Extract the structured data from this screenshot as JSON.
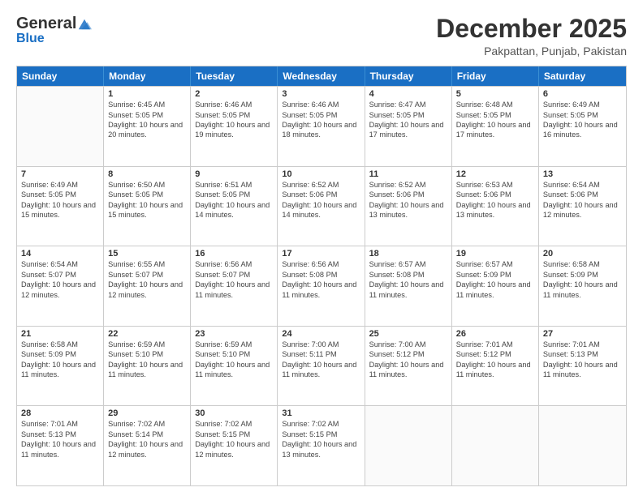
{
  "logo": {
    "general": "General",
    "blue": "Blue"
  },
  "header": {
    "month_year": "December 2025",
    "location": "Pakpattan, Punjab, Pakistan"
  },
  "days_of_week": [
    "Sunday",
    "Monday",
    "Tuesday",
    "Wednesday",
    "Thursday",
    "Friday",
    "Saturday"
  ],
  "weeks": [
    [
      {
        "day": "",
        "sunrise": "",
        "sunset": "",
        "daylight": ""
      },
      {
        "day": "1",
        "sunrise": "Sunrise: 6:45 AM",
        "sunset": "Sunset: 5:05 PM",
        "daylight": "Daylight: 10 hours and 20 minutes."
      },
      {
        "day": "2",
        "sunrise": "Sunrise: 6:46 AM",
        "sunset": "Sunset: 5:05 PM",
        "daylight": "Daylight: 10 hours and 19 minutes."
      },
      {
        "day": "3",
        "sunrise": "Sunrise: 6:46 AM",
        "sunset": "Sunset: 5:05 PM",
        "daylight": "Daylight: 10 hours and 18 minutes."
      },
      {
        "day": "4",
        "sunrise": "Sunrise: 6:47 AM",
        "sunset": "Sunset: 5:05 PM",
        "daylight": "Daylight: 10 hours and 17 minutes."
      },
      {
        "day": "5",
        "sunrise": "Sunrise: 6:48 AM",
        "sunset": "Sunset: 5:05 PM",
        "daylight": "Daylight: 10 hours and 17 minutes."
      },
      {
        "day": "6",
        "sunrise": "Sunrise: 6:49 AM",
        "sunset": "Sunset: 5:05 PM",
        "daylight": "Daylight: 10 hours and 16 minutes."
      }
    ],
    [
      {
        "day": "7",
        "sunrise": "Sunrise: 6:49 AM",
        "sunset": "Sunset: 5:05 PM",
        "daylight": "Daylight: 10 hours and 15 minutes."
      },
      {
        "day": "8",
        "sunrise": "Sunrise: 6:50 AM",
        "sunset": "Sunset: 5:05 PM",
        "daylight": "Daylight: 10 hours and 15 minutes."
      },
      {
        "day": "9",
        "sunrise": "Sunrise: 6:51 AM",
        "sunset": "Sunset: 5:05 PM",
        "daylight": "Daylight: 10 hours and 14 minutes."
      },
      {
        "day": "10",
        "sunrise": "Sunrise: 6:52 AM",
        "sunset": "Sunset: 5:06 PM",
        "daylight": "Daylight: 10 hours and 14 minutes."
      },
      {
        "day": "11",
        "sunrise": "Sunrise: 6:52 AM",
        "sunset": "Sunset: 5:06 PM",
        "daylight": "Daylight: 10 hours and 13 minutes."
      },
      {
        "day": "12",
        "sunrise": "Sunrise: 6:53 AM",
        "sunset": "Sunset: 5:06 PM",
        "daylight": "Daylight: 10 hours and 13 minutes."
      },
      {
        "day": "13",
        "sunrise": "Sunrise: 6:54 AM",
        "sunset": "Sunset: 5:06 PM",
        "daylight": "Daylight: 10 hours and 12 minutes."
      }
    ],
    [
      {
        "day": "14",
        "sunrise": "Sunrise: 6:54 AM",
        "sunset": "Sunset: 5:07 PM",
        "daylight": "Daylight: 10 hours and 12 minutes."
      },
      {
        "day": "15",
        "sunrise": "Sunrise: 6:55 AM",
        "sunset": "Sunset: 5:07 PM",
        "daylight": "Daylight: 10 hours and 12 minutes."
      },
      {
        "day": "16",
        "sunrise": "Sunrise: 6:56 AM",
        "sunset": "Sunset: 5:07 PM",
        "daylight": "Daylight: 10 hours and 11 minutes."
      },
      {
        "day": "17",
        "sunrise": "Sunrise: 6:56 AM",
        "sunset": "Sunset: 5:08 PM",
        "daylight": "Daylight: 10 hours and 11 minutes."
      },
      {
        "day": "18",
        "sunrise": "Sunrise: 6:57 AM",
        "sunset": "Sunset: 5:08 PM",
        "daylight": "Daylight: 10 hours and 11 minutes."
      },
      {
        "day": "19",
        "sunrise": "Sunrise: 6:57 AM",
        "sunset": "Sunset: 5:09 PM",
        "daylight": "Daylight: 10 hours and 11 minutes."
      },
      {
        "day": "20",
        "sunrise": "Sunrise: 6:58 AM",
        "sunset": "Sunset: 5:09 PM",
        "daylight": "Daylight: 10 hours and 11 minutes."
      }
    ],
    [
      {
        "day": "21",
        "sunrise": "Sunrise: 6:58 AM",
        "sunset": "Sunset: 5:09 PM",
        "daylight": "Daylight: 10 hours and 11 minutes."
      },
      {
        "day": "22",
        "sunrise": "Sunrise: 6:59 AM",
        "sunset": "Sunset: 5:10 PM",
        "daylight": "Daylight: 10 hours and 11 minutes."
      },
      {
        "day": "23",
        "sunrise": "Sunrise: 6:59 AM",
        "sunset": "Sunset: 5:10 PM",
        "daylight": "Daylight: 10 hours and 11 minutes."
      },
      {
        "day": "24",
        "sunrise": "Sunrise: 7:00 AM",
        "sunset": "Sunset: 5:11 PM",
        "daylight": "Daylight: 10 hours and 11 minutes."
      },
      {
        "day": "25",
        "sunrise": "Sunrise: 7:00 AM",
        "sunset": "Sunset: 5:12 PM",
        "daylight": "Daylight: 10 hours and 11 minutes."
      },
      {
        "day": "26",
        "sunrise": "Sunrise: 7:01 AM",
        "sunset": "Sunset: 5:12 PM",
        "daylight": "Daylight: 10 hours and 11 minutes."
      },
      {
        "day": "27",
        "sunrise": "Sunrise: 7:01 AM",
        "sunset": "Sunset: 5:13 PM",
        "daylight": "Daylight: 10 hours and 11 minutes."
      }
    ],
    [
      {
        "day": "28",
        "sunrise": "Sunrise: 7:01 AM",
        "sunset": "Sunset: 5:13 PM",
        "daylight": "Daylight: 10 hours and 11 minutes."
      },
      {
        "day": "29",
        "sunrise": "Sunrise: 7:02 AM",
        "sunset": "Sunset: 5:14 PM",
        "daylight": "Daylight: 10 hours and 12 minutes."
      },
      {
        "day": "30",
        "sunrise": "Sunrise: 7:02 AM",
        "sunset": "Sunset: 5:15 PM",
        "daylight": "Daylight: 10 hours and 12 minutes."
      },
      {
        "day": "31",
        "sunrise": "Sunrise: 7:02 AM",
        "sunset": "Sunset: 5:15 PM",
        "daylight": "Daylight: 10 hours and 13 minutes."
      },
      {
        "day": "",
        "sunrise": "",
        "sunset": "",
        "daylight": ""
      },
      {
        "day": "",
        "sunrise": "",
        "sunset": "",
        "daylight": ""
      },
      {
        "day": "",
        "sunrise": "",
        "sunset": "",
        "daylight": ""
      }
    ]
  ]
}
